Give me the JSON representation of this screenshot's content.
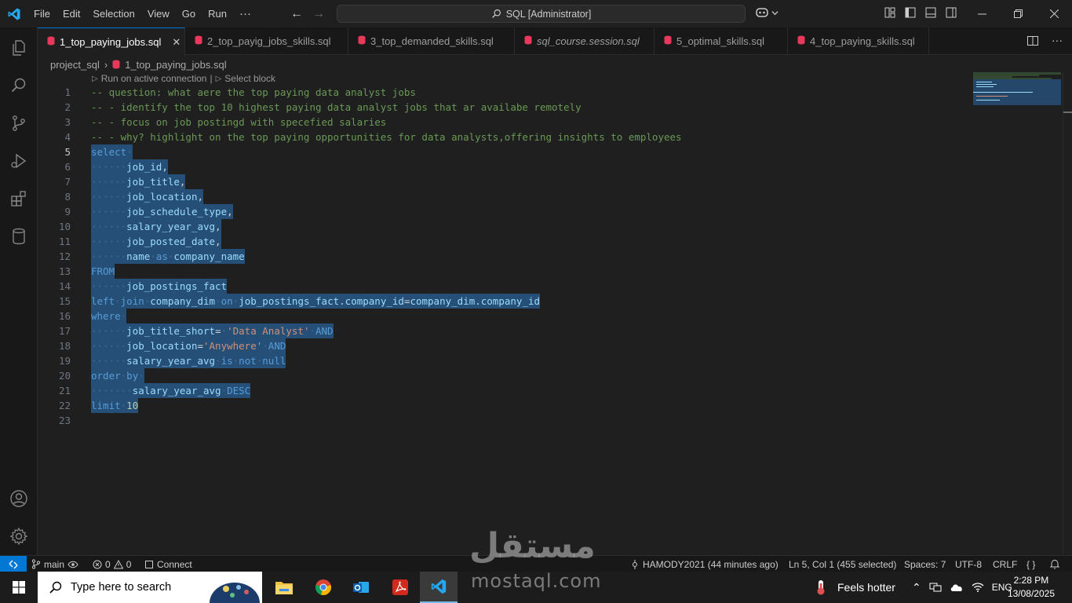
{
  "titlebar": {
    "menu": [
      "File",
      "Edit",
      "Selection",
      "View",
      "Go",
      "Run",
      "···"
    ],
    "command_center": "SQL [Administrator]"
  },
  "tabs": [
    {
      "label": "1_top_paying_jobs.sql",
      "active": true,
      "italic": false
    },
    {
      "label": "2_top_payig_jobs_skills.sql",
      "active": false,
      "italic": false
    },
    {
      "label": "3_top_demanded_skills.sql",
      "active": false,
      "italic": false
    },
    {
      "label": "sql_course.session.sql",
      "active": false,
      "italic": true
    },
    {
      "label": "5_optimal_skills.sql",
      "active": false,
      "italic": false
    },
    {
      "label": "4_top_paying_skills.sql",
      "active": false,
      "italic": false
    }
  ],
  "breadcrumb": {
    "folder": "project_sql",
    "file": "1_top_paying_jobs.sql"
  },
  "codelens": {
    "run": "Run on active connection",
    "select": "Select block"
  },
  "editor": {
    "current_line": 5,
    "lines": [
      "-- question: what aere the top paying data analyst jobs",
      "-- - identify the top 10 highest paying data analyst jobs that ar availabe remotely",
      "-- - focus on job postingd with specefied salaries",
      "-- - why? highlight on the top paying opportunities for data analysts,offering insights to employees",
      "select ",
      "      job_id,",
      "      job_title,",
      "      job_location,",
      "      job_schedule_type,",
      "      salary_year_avg,",
      "      job_posted_date,",
      "      name as company_name",
      "FROM",
      "      job_postings_fact",
      "left join company_dim on job_postings_fact.company_id=company_dim.company_id",
      "where ",
      "      job_title_short= 'Data Analyst' AND",
      "      job_location='Anywhere' AND",
      "      salary_year_avg is not null",
      "order by ",
      "       salary_year_avg DESC",
      "limit 10",
      ""
    ]
  },
  "statusbar": {
    "branch": "main",
    "errors": "0",
    "warnings": "0",
    "connect": "Connect",
    "blame": "HAMODY2021 (44 minutes ago)",
    "position": "Ln 5, Col 1 (455 selected)",
    "spaces": "Spaces: 7",
    "encoding": "UTF-8",
    "eol": "CRLF",
    "language": "{ }"
  },
  "taskbar": {
    "search_placeholder": "Type here to search",
    "weather": "Feels hotter",
    "language": "ENG",
    "time": "2:28 PM",
    "date": "13/08/2025"
  },
  "watermark": {
    "arabic": "مستقل",
    "latin": "mostaql.com"
  },
  "colors": {
    "accent": "#0078d4",
    "selection": "#264f78",
    "comment": "#6a9955",
    "keyword": "#569cd6",
    "identifier": "#9cdcfe",
    "string": "#ce9178",
    "number": "#b5cea8",
    "sql_file_icon": "#e8385c"
  }
}
